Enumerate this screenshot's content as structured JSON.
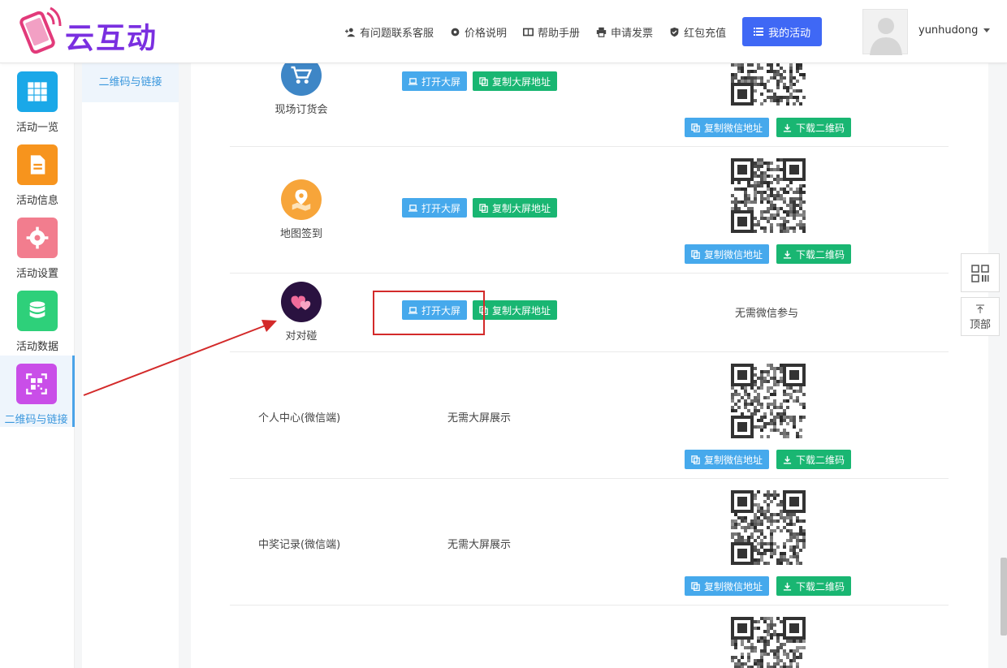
{
  "header": {
    "logo_text": "云互动",
    "nav": [
      {
        "icon": "add-user-icon",
        "label": "有问题联系客服"
      },
      {
        "icon": "gear-icon",
        "label": "价格说明"
      },
      {
        "icon": "book-icon",
        "label": "帮助手册"
      },
      {
        "icon": "printer-icon",
        "label": "申请发票"
      },
      {
        "icon": "shield-icon",
        "label": "红包充值"
      }
    ],
    "my_activity": "我的活动",
    "username": "yunhudong"
  },
  "sidebar": {
    "items": [
      {
        "label": "活动一览",
        "icon": "grid-icon",
        "color": "#1aa8e8"
      },
      {
        "label": "活动信息",
        "icon": "document-icon",
        "color": "#f7941d"
      },
      {
        "label": "活动设置",
        "icon": "gear-icon",
        "color": "#f27d8e"
      },
      {
        "label": "活动数据",
        "icon": "database-icon",
        "color": "#2ed07a"
      },
      {
        "label": "二维码与链接",
        "icon": "qrcode-icon",
        "color": "#c94ee8"
      }
    ]
  },
  "subnav": {
    "active": "二维码与链接"
  },
  "buttons": {
    "open_screen": "打开大屏",
    "copy_screen": "复制大屏地址",
    "copy_wechat": "复制微信地址",
    "download_qr": "下载二维码"
  },
  "rows": [
    {
      "name": "现场订货会",
      "icon": "cart-icon",
      "color": "#3e86c6"
    },
    {
      "name": "地图签到",
      "icon": "map-pin-icon",
      "color": "#f7a53a"
    },
    {
      "name": "对对碰",
      "icon": "hearts-icon",
      "color": "#2a1240",
      "wechat_text": "无需微信参与"
    },
    {
      "name": "个人中心(微信端)",
      "screen_text": "无需大屏展示"
    },
    {
      "name": "中奖记录(微信端)",
      "screen_text": "无需大屏展示"
    }
  ],
  "tools": {
    "top_label": "顶部"
  }
}
